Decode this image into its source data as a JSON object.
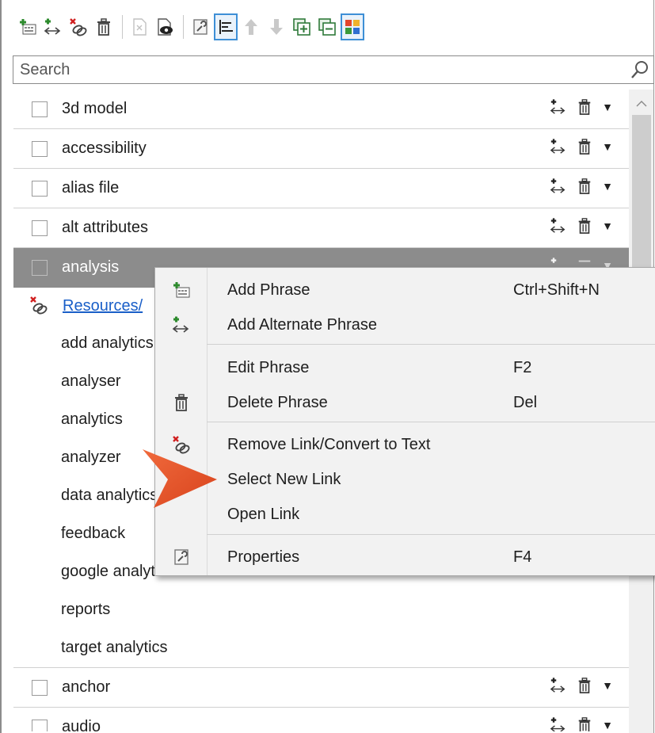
{
  "toolbar": {
    "buttons": [
      {
        "icon": "add-phrase-icon"
      },
      {
        "icon": "add-alternate-phrase-icon"
      },
      {
        "icon": "remove-link-icon"
      },
      {
        "icon": "delete-icon"
      },
      {
        "icon": "document-icon"
      },
      {
        "icon": "preview-icon"
      },
      {
        "icon": "properties-icon"
      },
      {
        "icon": "sort-icon"
      },
      {
        "icon": "move-up-icon"
      },
      {
        "icon": "move-down-icon"
      },
      {
        "icon": "expand-all-icon"
      },
      {
        "icon": "collapse-all-icon"
      },
      {
        "icon": "grid-view-icon"
      }
    ]
  },
  "search": {
    "placeholder": "Search"
  },
  "list": {
    "rows_top": [
      {
        "label": "3d model"
      },
      {
        "label": "accessibility"
      },
      {
        "label": "alias file"
      },
      {
        "label": "alt attributes"
      }
    ],
    "selected_row": {
      "label": "analysis"
    },
    "link_text": "Resources/",
    "sub_items": [
      "add analytics",
      "analyser",
      "analytics",
      "analyzer",
      "data analytics",
      "feedback",
      "google analytics",
      "reports",
      "target analytics"
    ],
    "rows_bottom": [
      {
        "label": "anchor"
      },
      {
        "label": "audio"
      }
    ]
  },
  "context_menu": {
    "items": [
      {
        "label": "Add Phrase",
        "shortcut": "Ctrl+Shift+N",
        "icon": "add-phrase-icon"
      },
      {
        "label": "Add Alternate Phrase",
        "shortcut": "",
        "icon": "add-alternate-phrase-icon"
      },
      {
        "label": "Edit Phrase",
        "shortcut": "F2",
        "icon": ""
      },
      {
        "label": "Delete Phrase",
        "shortcut": "Del",
        "icon": "delete-icon"
      },
      {
        "label": "Remove Link/Convert to Text",
        "shortcut": "",
        "icon": "remove-link-icon"
      },
      {
        "label": "Select New Link",
        "shortcut": "",
        "icon": ""
      },
      {
        "label": "Open Link",
        "shortcut": "",
        "icon": ""
      },
      {
        "label": "Properties",
        "shortcut": "F4",
        "icon": "properties-icon"
      }
    ]
  },
  "colors": {
    "accent": "#e8502a",
    "selected_row": "#8c8c8c",
    "link": "#1a5fc8"
  }
}
